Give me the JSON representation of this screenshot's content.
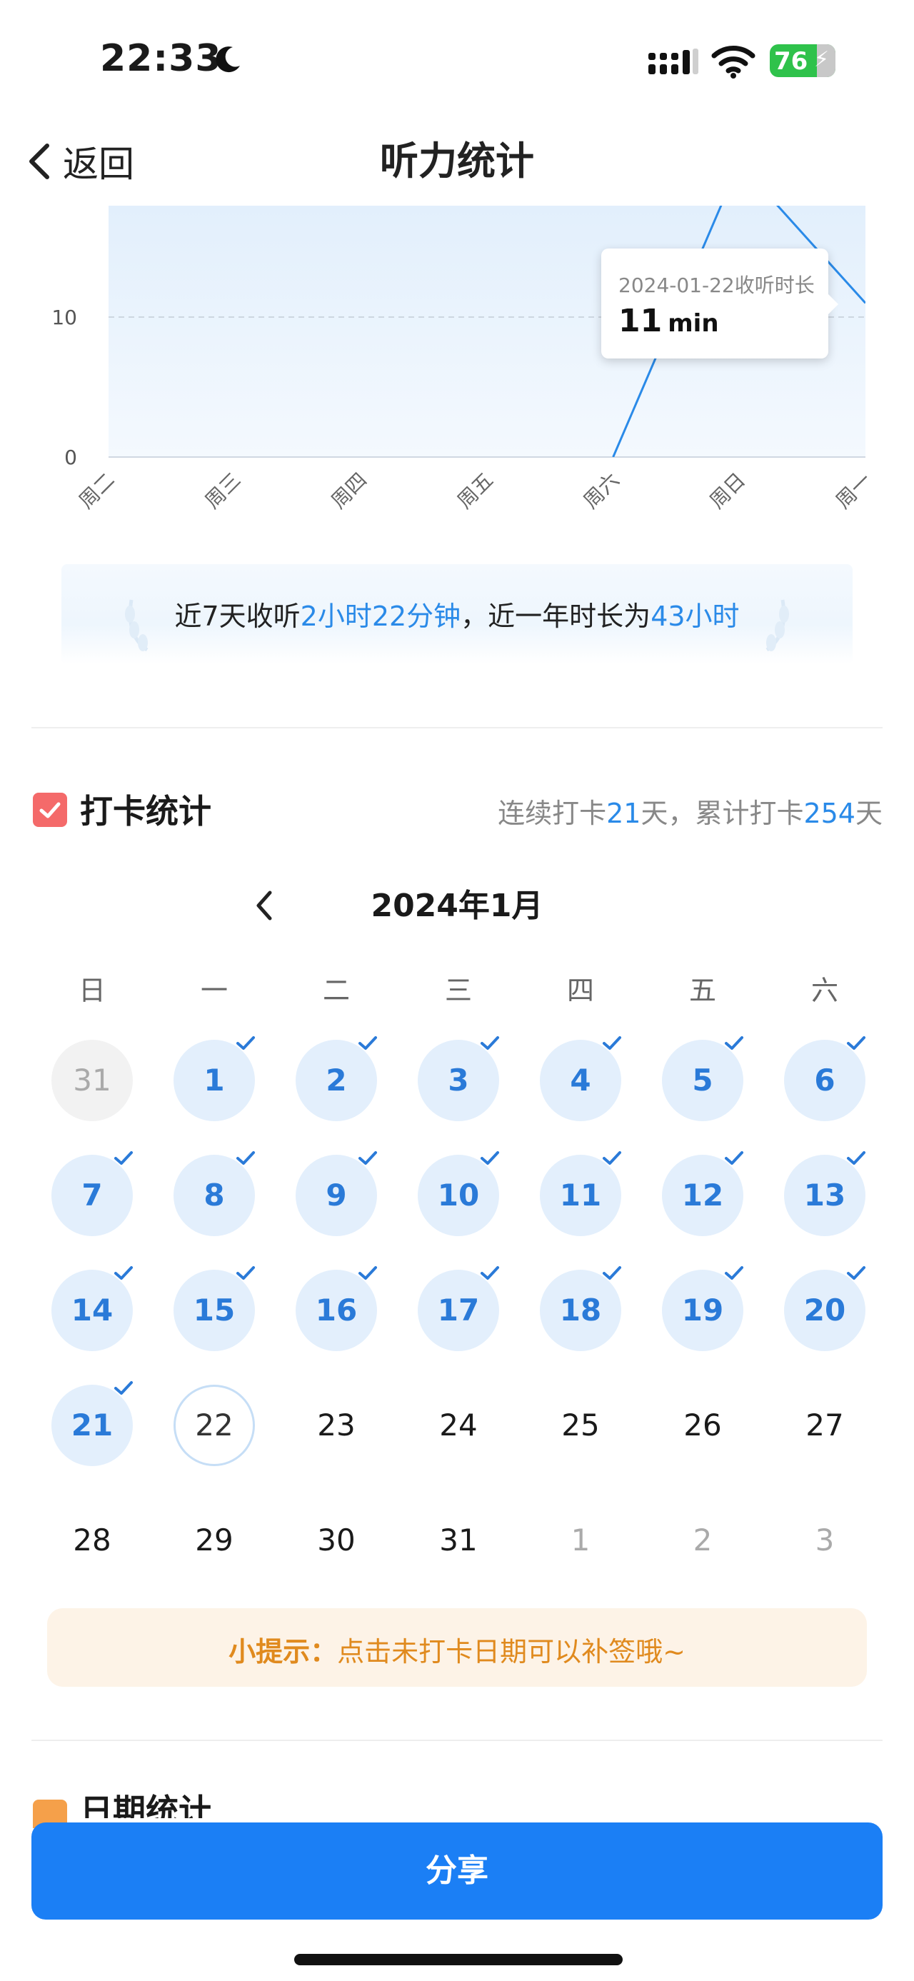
{
  "status_bar": {
    "time": "22:33",
    "battery": "76"
  },
  "nav": {
    "back_label": "返回",
    "title": "听力统计"
  },
  "chart_data": {
    "type": "area",
    "categories": [
      "周二",
      "周三",
      "周四",
      "周五",
      "周六",
      "周日",
      "周一"
    ],
    "values": [
      0,
      0,
      0,
      0,
      0,
      21,
      11
    ],
    "y_ticks": [
      "0",
      "10"
    ],
    "ylim": [
      0,
      18
    ],
    "grid": "dashed at 10",
    "tooltip": {
      "label": "2024-01-22收听时长",
      "value": "11",
      "unit": "min"
    }
  },
  "summary": {
    "part1": "近7天收听",
    "listen_7d": "2小时22分钟",
    "part2": "，近一年时长为",
    "listen_year": "43小时"
  },
  "checkin": {
    "title": "打卡统计",
    "streak_prefix": "连续打卡",
    "streak": "21",
    "streak_suffix": "天，累计打卡",
    "total": "254",
    "total_suffix": "天"
  },
  "calendar": {
    "month_title": "2024年1月",
    "weekdays": [
      "日",
      "一",
      "二",
      "三",
      "四",
      "五",
      "六"
    ],
    "weeks": [
      [
        {
          "d": "31",
          "s": "prev"
        },
        {
          "d": "1",
          "s": "done"
        },
        {
          "d": "2",
          "s": "done"
        },
        {
          "d": "3",
          "s": "done"
        },
        {
          "d": "4",
          "s": "done"
        },
        {
          "d": "5",
          "s": "done"
        },
        {
          "d": "6",
          "s": "done"
        }
      ],
      [
        {
          "d": "7",
          "s": "done"
        },
        {
          "d": "8",
          "s": "done"
        },
        {
          "d": "9",
          "s": "done"
        },
        {
          "d": "10",
          "s": "done"
        },
        {
          "d": "11",
          "s": "done"
        },
        {
          "d": "12",
          "s": "done"
        },
        {
          "d": "13",
          "s": "done"
        }
      ],
      [
        {
          "d": "14",
          "s": "done"
        },
        {
          "d": "15",
          "s": "done"
        },
        {
          "d": "16",
          "s": "done"
        },
        {
          "d": "17",
          "s": "done"
        },
        {
          "d": "18",
          "s": "done"
        },
        {
          "d": "19",
          "s": "done"
        },
        {
          "d": "20",
          "s": "done"
        }
      ],
      [
        {
          "d": "21",
          "s": "done"
        },
        {
          "d": "22",
          "s": "today"
        },
        {
          "d": "23",
          "s": "plain"
        },
        {
          "d": "24",
          "s": "plain"
        },
        {
          "d": "25",
          "s": "plain"
        },
        {
          "d": "26",
          "s": "plain"
        },
        {
          "d": "27",
          "s": "plain"
        }
      ],
      [
        {
          "d": "28",
          "s": "plain"
        },
        {
          "d": "29",
          "s": "plain"
        },
        {
          "d": "30",
          "s": "plain"
        },
        {
          "d": "31",
          "s": "plain"
        },
        {
          "d": "1",
          "s": "next"
        },
        {
          "d": "2",
          "s": "next"
        },
        {
          "d": "3",
          "s": "next"
        }
      ]
    ]
  },
  "tip": {
    "prefix": "小提示：",
    "text": "点击未打卡日期可以补签哦~"
  },
  "next_section": {
    "title": "日期统计"
  },
  "share_label": "分享",
  "colors": {
    "accent": "#1b7ff5",
    "done_bg": "#e3effc",
    "tip_text": "#e08a1e"
  }
}
